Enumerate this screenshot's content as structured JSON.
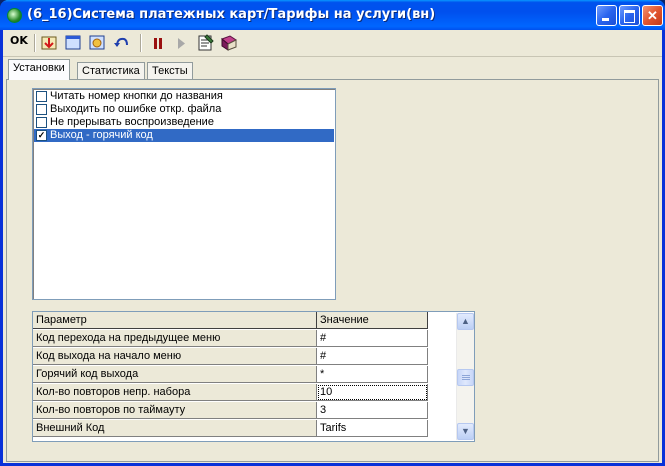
{
  "window": {
    "title": "(6_16)Система платежных карт/Тарифы на услуги(вн)",
    "minimize_icon": "minimize-icon",
    "maximize_icon": "maximize-icon",
    "close_icon": "close-icon"
  },
  "toolbar": {
    "ok_label": "OK",
    "icons": [
      "save-down-arrow-icon",
      "window-icon",
      "record-icon",
      "undo-arrow-icon",
      "pause-icon",
      "play-icon",
      "notes-icon",
      "book-icon"
    ]
  },
  "tabs": [
    {
      "label": "Установки",
      "active": true
    },
    {
      "label": "Статистика",
      "active": false
    },
    {
      "label": "Тексты",
      "active": false
    }
  ],
  "options": [
    {
      "label": "Читать номер кнопки до названия",
      "checked": false,
      "selected": false
    },
    {
      "label": "Выходить по  ошибке откр. файла",
      "checked": false,
      "selected": false
    },
    {
      "label": "Не прерывать воспроизведение",
      "checked": false,
      "selected": false
    },
    {
      "label": "Выход - горячий код",
      "checked": true,
      "selected": true
    }
  ],
  "grid": {
    "headers": {
      "param": "Параметр",
      "value": "Значение"
    },
    "rows": [
      {
        "param": "Код перехода на предыдущее меню",
        "value": "#"
      },
      {
        "param": "Код выхода на начало меню",
        "value": "#"
      },
      {
        "param": "Горячий код выхода",
        "value": "*"
      },
      {
        "param": "Кол-во повторов непр. набора",
        "value": "10"
      },
      {
        "param": "Кол-во повторов по таймауту",
        "value": "3"
      },
      {
        "param": "Внешний Код",
        "value": "Tarifs"
      }
    ]
  },
  "colors": {
    "title_bar": "#0054e3",
    "selection": "#316ac5",
    "window_face": "#ece9d8"
  }
}
